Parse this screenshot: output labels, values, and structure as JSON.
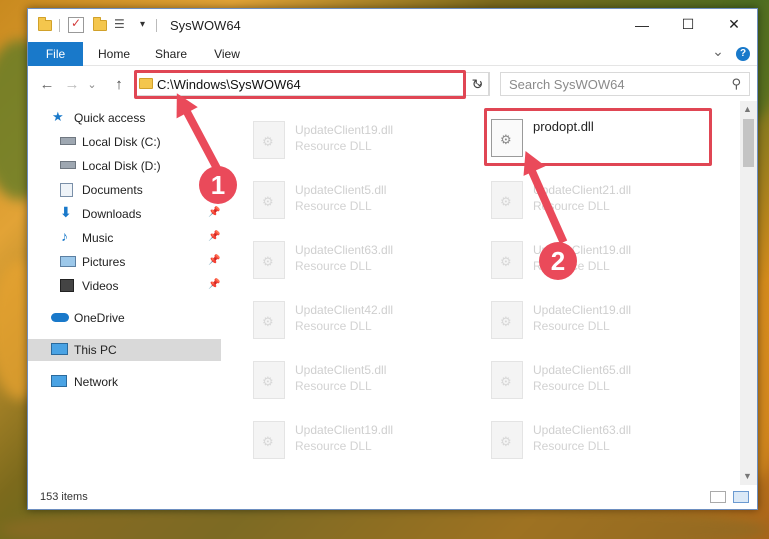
{
  "window": {
    "title": "SysWOW64",
    "minimize_glyph": "—",
    "maximize_glyph": "☐",
    "close_glyph": "✕"
  },
  "ribbon": {
    "tabs": [
      "File",
      "Home",
      "Share",
      "View"
    ],
    "expand_glyph": "⌄",
    "help_glyph": "?"
  },
  "navbar": {
    "back_glyph": "←",
    "forward_glyph": "→",
    "recent_glyph": "⌄",
    "up_glyph": "↑",
    "address": "C:\\Windows\\SysWOW64",
    "refresh_glyph": "↻",
    "search_placeholder": "Search SysWOW64"
  },
  "sidebar": {
    "items": [
      {
        "label": "Quick access",
        "icon": "star-icon",
        "pinned": false
      },
      {
        "label": "Local Disk (C:)",
        "icon": "drive-icon",
        "pinned": false
      },
      {
        "label": "Local Disk (D:)",
        "icon": "drive-icon",
        "pinned": false
      },
      {
        "label": "Documents",
        "icon": "documents-icon",
        "pinned": true
      },
      {
        "label": "Downloads",
        "icon": "download-icon",
        "pinned": true
      },
      {
        "label": "Music",
        "icon": "music-icon",
        "pinned": true
      },
      {
        "label": "Pictures",
        "icon": "pictures-icon",
        "pinned": true
      },
      {
        "label": "Videos",
        "icon": "videos-icon",
        "pinned": true
      },
      {
        "label": "OneDrive",
        "icon": "cloud-icon",
        "pinned": false
      },
      {
        "label": "This PC",
        "icon": "computer-icon",
        "pinned": false
      },
      {
        "label": "Network",
        "icon": "network-icon",
        "pinned": false
      }
    ]
  },
  "files": [
    {
      "name": "UpdateClient19.dll",
      "type": "Resource DLL"
    },
    {
      "name": "prodopt.dll",
      "type": ""
    },
    {
      "name": "UpdateClient5.dll",
      "type": "Resource DLL"
    },
    {
      "name": "UpdateClient21.dll",
      "type": "Resource DLL"
    },
    {
      "name": "UpdateClient63.dll",
      "type": "Resource DLL"
    },
    {
      "name": "UpdateClient19.dll",
      "type": "Resource DLL"
    },
    {
      "name": "UpdateClient42.dll",
      "type": "Resource DLL"
    },
    {
      "name": "UpdateClient19.dll",
      "type": "Resource DLL"
    },
    {
      "name": "UpdateClient5.dll",
      "type": "Resource DLL"
    },
    {
      "name": "UpdateClient65.dll",
      "type": "Resource DLL"
    },
    {
      "name": "UpdateClient19.dll",
      "type": "Resource DLL"
    },
    {
      "name": "UpdateClient63.dll",
      "type": "Resource DLL"
    }
  ],
  "status": {
    "item_count": "153 items"
  },
  "callouts": {
    "step1": "1",
    "step2": "2",
    "color": "#ea4a5a"
  },
  "colors": {
    "file_tab": "#1979ca",
    "highlight": "#e04654"
  }
}
